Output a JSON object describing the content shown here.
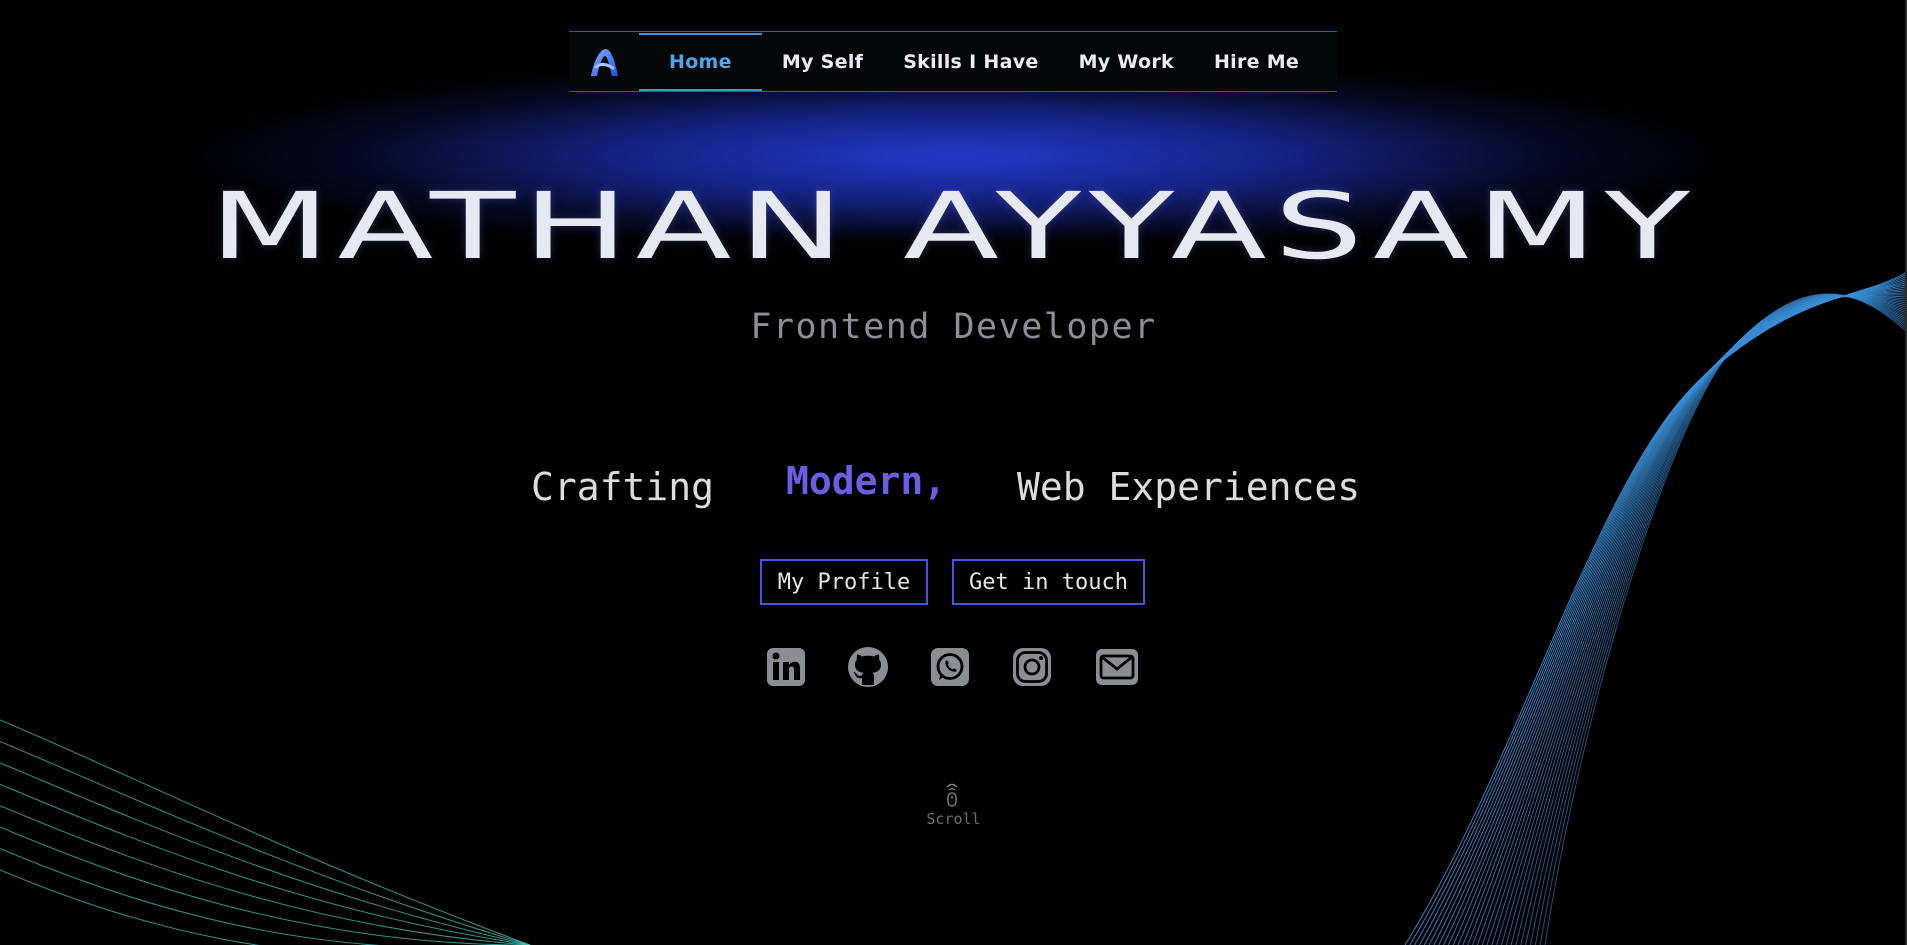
{
  "nav": {
    "logo_icon": "letter-a-logo-icon",
    "items": [
      {
        "label": "Home",
        "active": true
      },
      {
        "label": "My Self",
        "active": false
      },
      {
        "label": "Skills I Have",
        "active": false
      },
      {
        "label": "My Work",
        "active": false
      },
      {
        "label": "Hire Me",
        "active": false
      }
    ]
  },
  "hero": {
    "name": "MATHAN AYYASAMY",
    "role": "Frontend Developer",
    "tagline": {
      "word1": "Crafting",
      "word2": "Modern,",
      "word3": "Web Experiences"
    }
  },
  "buttons": {
    "profile": "My Profile",
    "contact": "Get in touch"
  },
  "social": [
    "linkedin-icon",
    "github-icon",
    "whatsapp-icon",
    "instagram-icon",
    "mail-icon"
  ],
  "scroll": {
    "label": "Scroll",
    "icon": "mouse-scroll-icon"
  },
  "colors": {
    "background": "#000000",
    "accent_blue": "#3f57e8",
    "nav_active": "#4ea6ea",
    "highlight_word": "#6a5ee6",
    "name_text": "#e6e8f2",
    "muted_text": "#8c8f96",
    "icon_gray": "#8a8d94",
    "wave_right": "#3a8fd8",
    "wave_left": "#3ec7b8"
  }
}
